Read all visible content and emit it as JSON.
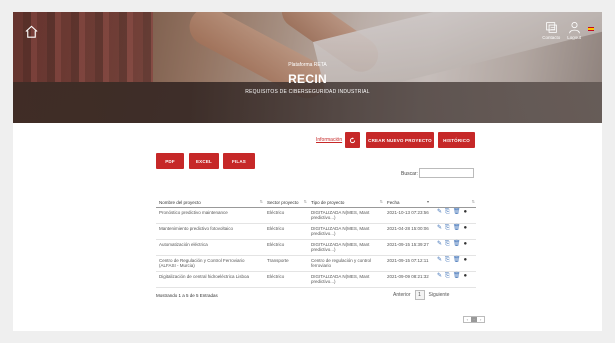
{
  "hero": {
    "subtitle": "Plataforma RETA",
    "title": "RECIN",
    "tagline": "REQUISITOS DE CIBERSEGURIDAD INDUSTRIAL"
  },
  "topbar": {
    "contact_label": "Contacto",
    "logout_label": "Logout"
  },
  "actions": {
    "info_label": "Información",
    "create_label": "CREAR NUEVO PROYECTO",
    "history_label": "HISTÓRICO"
  },
  "export": {
    "pdf_label": "PDF",
    "excel_label": "EXCEL",
    "filas_label": "FILAS"
  },
  "search": {
    "label": "Buscar:"
  },
  "table": {
    "headers": {
      "name": "Nombre del proyecto",
      "sector": "Sector proyecto",
      "type": "Tipo de proyecto",
      "date": "Fecha"
    },
    "rows": [
      {
        "name": "Pronóstico predictivo maintenance",
        "sector": "Eléctrico",
        "type": "DIGITALIZADA N(MES, Mant predictivo...)",
        "date": "2021-10-13 07:23:56"
      },
      {
        "name": "Mantenimiento predictivo fotovoltaico",
        "sector": "Eléctrico",
        "type": "DIGITALIZADA N(MES, Mant predictivo...)",
        "date": "2021-04-28 15:00:06"
      },
      {
        "name": "Automatización eléctrica",
        "sector": "Eléctrico",
        "type": "DIGITALIZADA N(MES, Mant predictivo...)",
        "date": "2021-09-15 15:39:27"
      },
      {
        "name": "Centro de Regulación y Control Ferroviario (ALFASI - Murcia)",
        "sector": "Transporte",
        "type": "Centro de regulación y control ferroviario",
        "date": "2021-09-15 07:12:11"
      },
      {
        "name": "Digitalización de central hidroeléctrica Lisboa",
        "sector": "Eléctrico",
        "type": "DIGITALIZADA N(MES, Mant predictivo...)",
        "date": "2021-09-09 08:21:32"
      }
    ]
  },
  "footer": {
    "info": "Mostrando 1 a 5 de 5 Entradas",
    "prev_label": "Anterior",
    "page_label": "1",
    "next_label": "Siguiente"
  },
  "colors": {
    "accent": "#c62828",
    "action_icon": "#3b6fb6"
  }
}
